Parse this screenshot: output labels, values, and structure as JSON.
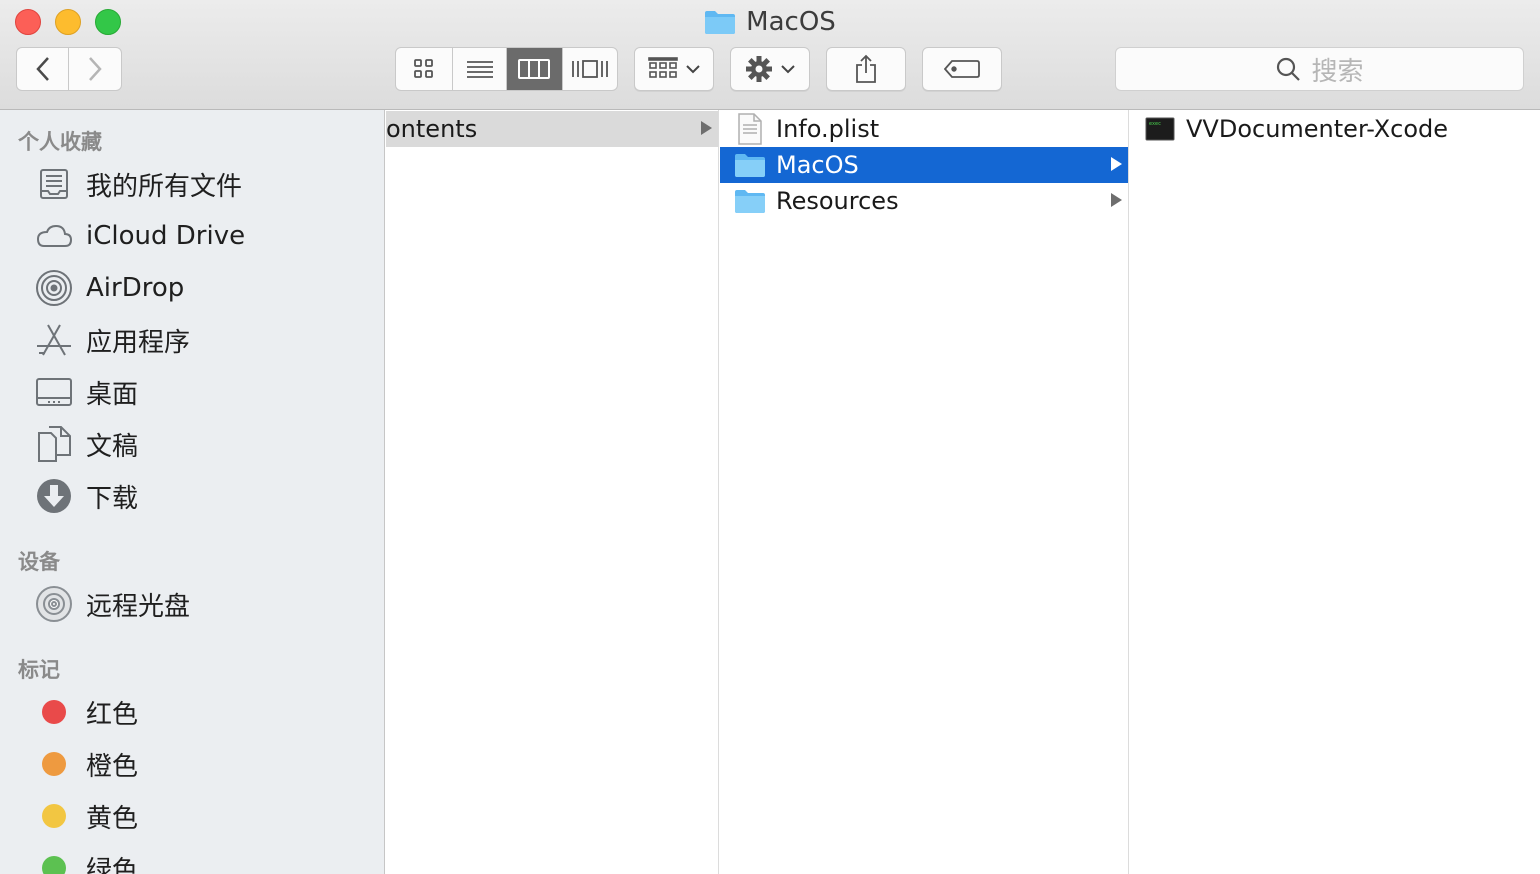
{
  "window": {
    "title": "MacOS"
  },
  "toolbar": {
    "search_placeholder": "搜索"
  },
  "sidebar": {
    "sections": [
      {
        "header": "个人收藏",
        "items": [
          {
            "label": "我的所有文件",
            "icon": "all-files-icon"
          },
          {
            "label": "iCloud Drive",
            "icon": "cloud-icon"
          },
          {
            "label": "AirDrop",
            "icon": "airdrop-icon"
          },
          {
            "label": "应用程序",
            "icon": "applications-icon"
          },
          {
            "label": "桌面",
            "icon": "desktop-icon"
          },
          {
            "label": "文稿",
            "icon": "documents-icon"
          },
          {
            "label": "下载",
            "icon": "downloads-icon"
          }
        ]
      },
      {
        "header": "设备",
        "items": [
          {
            "label": "远程光盘",
            "icon": "disc-icon"
          }
        ]
      },
      {
        "header": "标记",
        "items": [
          {
            "label": "红色",
            "color": "#e94a4a"
          },
          {
            "label": "橙色",
            "color": "#ee9a40"
          },
          {
            "label": "黄色",
            "color": "#f2c642"
          },
          {
            "label": "绿色",
            "color": "#5cc151"
          }
        ]
      }
    ]
  },
  "columns": {
    "col1": {
      "items": [
        {
          "label": "ontents",
          "has_children": true
        }
      ]
    },
    "col2": {
      "items": [
        {
          "label": "Info.plist",
          "icon": "plist-file-icon",
          "has_children": false
        },
        {
          "label": "MacOS",
          "icon": "folder-icon",
          "has_children": true,
          "selected": true
        },
        {
          "label": "Resources",
          "icon": "folder-icon",
          "has_children": true
        }
      ]
    },
    "col3": {
      "items": [
        {
          "label": "VVDocumenter-Xcode",
          "icon": "executable-icon"
        }
      ]
    }
  },
  "colors": {
    "selection": "#1467d3",
    "folder": "#5fb8f2"
  }
}
